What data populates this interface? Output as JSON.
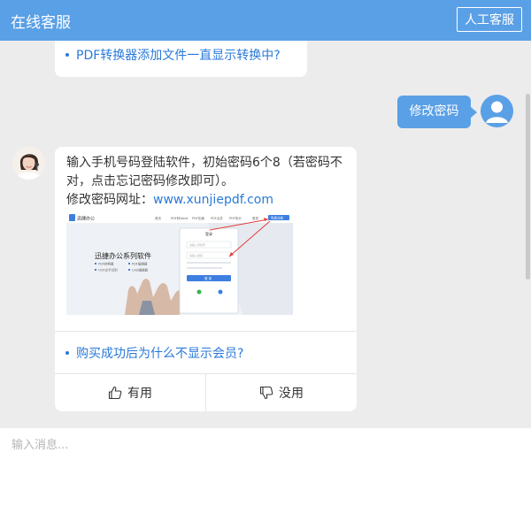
{
  "header": {
    "title": "在线客服",
    "human_service_label": "人工客服"
  },
  "chat": {
    "prev_faq": "PDF转换器添加文件一直显示转换中?",
    "user_message": "修改密码",
    "answer": {
      "line1": "输入手机号码登陆软件，初始密码6个8（若密码不对，点击忘记密码修改即可）。",
      "url_prefix": "修改密码网址：",
      "url": "www.xunjiepdf.com",
      "screenshot": {
        "brand": "迅捷办公",
        "nav": [
          "首页",
          "PDF转Word",
          "PDF压缩",
          "PDF合并",
          "PDF拆分",
          "登录"
        ],
        "register_label": "免费注册",
        "dialog_title": "登录",
        "hero_title": "迅捷办公系列软件",
        "hero_items": [
          "PDF转换器",
          "PDF编辑器",
          "OCR文字识别",
          "CAD编辑器"
        ],
        "login_button": "登 录",
        "phone_placeholder": "请输入手机号",
        "password_placeholder": "请输入密码"
      },
      "related_faq": "购买成功后为什么不显示会员?",
      "useful_label": "有用",
      "useless_label": "没用"
    }
  },
  "input": {
    "placeholder": "输入消息..."
  },
  "colors": {
    "brand_blue": "#5aa0e6",
    "link_blue": "#2a79d9",
    "background": "#ececec"
  }
}
